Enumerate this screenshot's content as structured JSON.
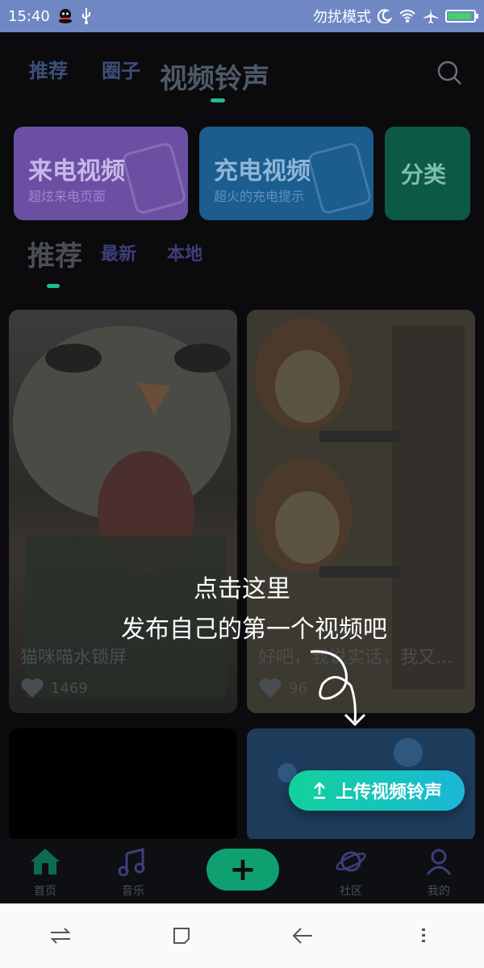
{
  "statusbar": {
    "time": "15:40",
    "dnd_label": "勿扰模式",
    "icons": [
      "qq-icon",
      "usb-icon",
      "moon-icon",
      "wifi-icon",
      "airplane-icon",
      "battery-icon"
    ]
  },
  "topnav": {
    "tabs": [
      "推荐",
      "圈子",
      "视频铃声"
    ],
    "active_tab": "视频铃声",
    "search_icon": "search-icon"
  },
  "feature_cards": [
    {
      "title": "来电视频",
      "subtitle": "超炫来电页面",
      "color": "#7b5fbf"
    },
    {
      "title": "充电视频",
      "subtitle": "超火的充电提示",
      "color": "#1a6ea6"
    },
    {
      "title": "分类",
      "subtitle": "",
      "color": "#0e6a55"
    }
  ],
  "subtabs": {
    "items": [
      "推荐",
      "最新",
      "本地"
    ],
    "active": "推荐"
  },
  "videos": [
    {
      "caption": "猫咪喵水锁屏",
      "likes": "1469"
    },
    {
      "caption": "好吧，我说实话，我又...",
      "likes": "96"
    },
    {
      "caption": "",
      "likes": ""
    },
    {
      "caption": "",
      "likes": ""
    }
  ],
  "guide": {
    "line1": "点击这里",
    "line2": "发布自己的第一个视频吧"
  },
  "upload_button": {
    "label": "上传视频铃声",
    "icon": "upload-icon"
  },
  "bottom_nav": [
    {
      "label": "首页",
      "icon": "home-icon"
    },
    {
      "label": "音乐",
      "icon": "music-icon"
    },
    {
      "label": "",
      "icon": "plus-icon"
    },
    {
      "label": "社区",
      "icon": "planet-icon"
    },
    {
      "label": "我的",
      "icon": "user-icon"
    }
  ],
  "system_nav": [
    "switch-icon",
    "square-icon",
    "back-icon",
    "menu-icon"
  ]
}
